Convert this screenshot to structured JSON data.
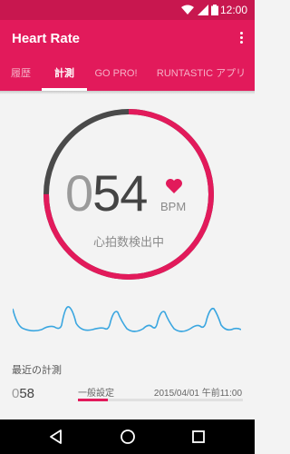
{
  "status_bar": {
    "time": "12:00"
  },
  "app_bar": {
    "title": "Heart Rate"
  },
  "tabs": [
    {
      "label": "履歴",
      "active": false
    },
    {
      "label": "計測",
      "active": true
    },
    {
      "label": "GO PRO!",
      "active": false
    },
    {
      "label": "RUNTASTIC アプリ",
      "active": false
    }
  ],
  "measurement": {
    "bpm_leading": "0",
    "bpm_value": "54",
    "unit": "BPM",
    "status": "心拍数検出中",
    "gauge_progress": 0.75
  },
  "recent": {
    "label": "最近の計測",
    "value_leading": "0",
    "value": "58",
    "mode": "一般設定",
    "date": "2015/04/01 午前11:00",
    "bar_fraction": 0.18
  },
  "colors": {
    "accent": "#e21a5b",
    "status_bar": "#c8174f",
    "gauge_track": "#4a4a4a",
    "wave": "#3aa6e0"
  },
  "icons": [
    "wifi-icon",
    "signal-icon",
    "battery-icon",
    "more-vert-icon",
    "heart-icon",
    "back-icon",
    "home-icon",
    "recents-icon"
  ]
}
